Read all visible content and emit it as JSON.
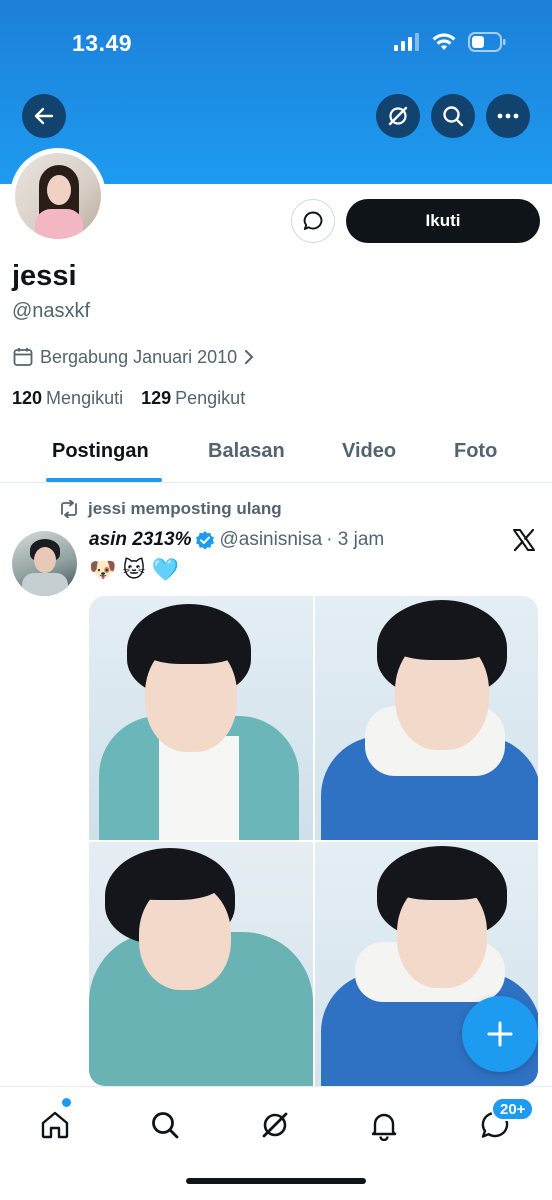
{
  "status_bar": {
    "time": "13.49"
  },
  "profile": {
    "name": "jessi",
    "handle": "@nasxkf",
    "joined": "Bergabung Januari 2010",
    "following_count": "120",
    "following_label": "Mengikuti",
    "followers_count": "129",
    "followers_label": "Pengikut",
    "follow_button": "Ikuti"
  },
  "tabs": [
    {
      "label": "Postingan",
      "active": true
    },
    {
      "label": "Balasan",
      "active": false
    },
    {
      "label": "Video",
      "active": false
    },
    {
      "label": "Foto",
      "active": false
    }
  ],
  "post": {
    "repost_label": "jessi memposting ulang",
    "author": "asin 2313%",
    "author_handle": "@asinisnisa",
    "time": "· 3 jam",
    "text": "🐶 🐱 🩵"
  },
  "bottom_nav": {
    "messages_badge": "20+"
  },
  "colors": {
    "accent": "#1d9bf0",
    "text": "#0f1419",
    "muted": "#536471"
  }
}
